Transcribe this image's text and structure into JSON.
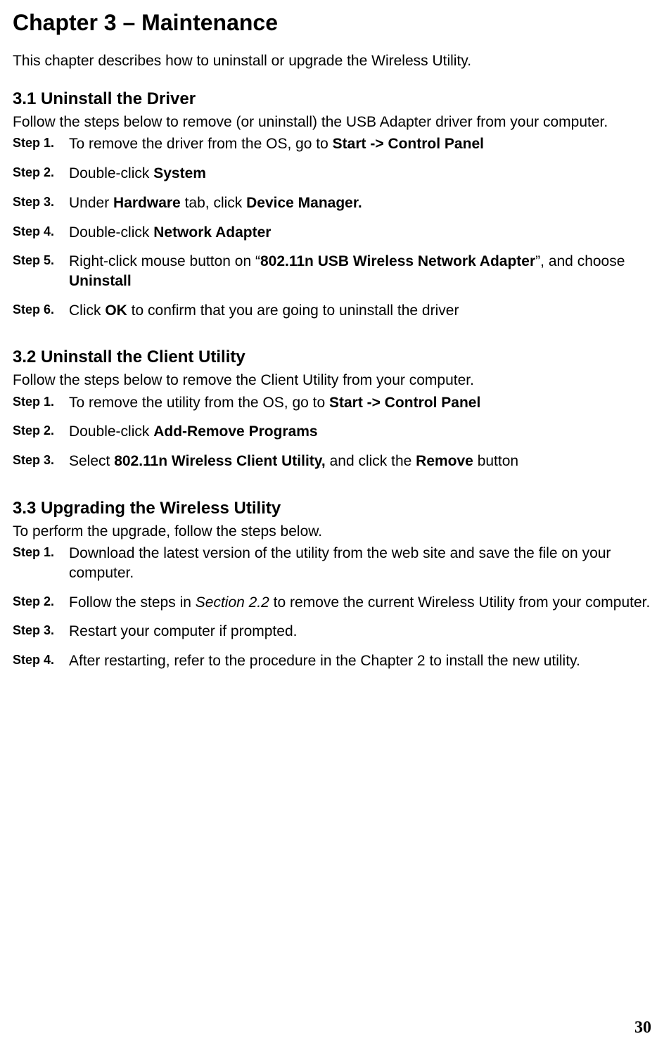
{
  "chapter_title": "Chapter 3 – Maintenance",
  "chapter_intro": "This chapter describes how to uninstall or upgrade the Wireless Utility.",
  "s31": {
    "heading": "3.1    Uninstall the Driver",
    "lead": "Follow the steps below to remove (or uninstall) the USB Adapter driver from your computer.",
    "steps": {
      "l1": "Step 1.",
      "t1a": "To remove the driver from the OS, go to ",
      "t1b": "Start -> Control Panel",
      "l2": "Step 2.",
      "t2a": "Double-click ",
      "t2b": "System",
      "l3": "Step 3.",
      "t3a": "Under ",
      "t3b": "Hardware",
      "t3c": " tab, click ",
      "t3d": "Device Manager.",
      "l4": "Step 4.",
      "t4a": "Double-click ",
      "t4b": "Network Adapter",
      "l5": "Step 5.",
      "t5a": "Right-click mouse button on “",
      "t5b": "802.11n USB Wireless Network Adapter",
      "t5c": "”, and choose ",
      "t5d": "Uninstall",
      "l6": "Step 6.",
      "t6a": "Click ",
      "t6b": "OK",
      "t6c": " to confirm that you are going to uninstall the driver"
    }
  },
  "s32": {
    "heading": "3.2    Uninstall the Client Utility",
    "lead": "Follow the steps below to remove the Client Utility from your computer.",
    "steps": {
      "l1": "Step 1.",
      "t1a": "To remove the utility from the OS, go to ",
      "t1b": "Start -> Control Panel",
      "l2": "Step 2.",
      "t2a": "Double-click ",
      "t2b": "Add-Remove Programs",
      "l3": "Step 3.",
      "t3a": "Select ",
      "t3b": "802.11n Wireless Client Utility,",
      "t3c": " and click the ",
      "t3d": "Remove",
      "t3e": " button"
    }
  },
  "s33": {
    "heading": "3.3    Upgrading the Wireless Utility",
    "lead": "To perform the upgrade, follow the steps below.",
    "steps": {
      "l1": "Step 1.",
      "t1": "Download the latest version of the utility from the web site and save the file on your computer.",
      "l2": "Step 2.",
      "t2a": "Follow the steps in ",
      "t2b": "Section 2.2",
      "t2c": "   to remove the current Wireless Utility from your computer.",
      "l3": "Step 3.",
      "t3": "Restart your computer if prompted.",
      "l4": "Step 4.",
      "t4": "After restarting, refer to the procedure in the Chapter 2 to install the new utility."
    }
  },
  "page_number": "30"
}
